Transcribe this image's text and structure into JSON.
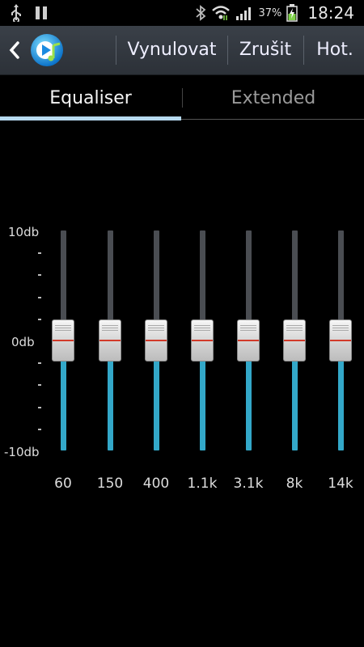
{
  "status_bar": {
    "battery_percent": "37%",
    "time": "18:24",
    "icons": [
      "usb-icon",
      "pause-icon",
      "bluetooth-icon",
      "wifi-icon",
      "signal-icon",
      "battery-charging-icon"
    ]
  },
  "action_bar": {
    "back_icon": "back-chevron-icon",
    "app_icon": "music-player-icon",
    "buttons": [
      "Vynulovat",
      "Zrušit",
      "Hot."
    ]
  },
  "tabs": [
    {
      "label": "Equaliser",
      "active": true
    },
    {
      "label": "Extended",
      "active": false
    }
  ],
  "scale": {
    "max_label": "10db",
    "zero_label": "0db",
    "min_label": "-10db",
    "minor_tick_char": "-"
  },
  "bands": [
    {
      "label": "60",
      "gain_db": 0
    },
    {
      "label": "150",
      "gain_db": 0
    },
    {
      "label": "400",
      "gain_db": 0
    },
    {
      "label": "1.1k",
      "gain_db": 0
    },
    {
      "label": "3.1k",
      "gain_db": 0
    },
    {
      "label": "8k",
      "gain_db": 0
    },
    {
      "label": "14k",
      "gain_db": 0
    }
  ],
  "colors": {
    "accent_track": "#33a8c9",
    "tab_indicator": "#b6d9ef",
    "thumb_center_line": "#d23a2a"
  }
}
